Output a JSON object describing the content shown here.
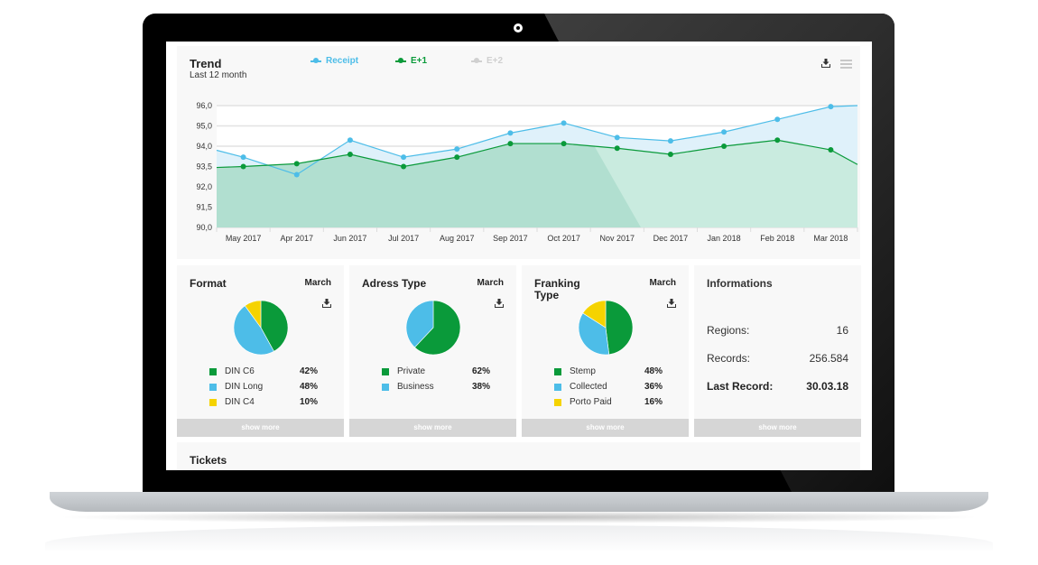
{
  "trend": {
    "title": "Trend",
    "subtitle": "Last 12 month",
    "legend": [
      {
        "label": "Receipt",
        "color": "#4dbde8"
      },
      {
        "label": "E+1",
        "color": "#0a9a3a"
      },
      {
        "label": "E+2",
        "color": "#d0d0d0"
      }
    ],
    "download_icon": "download-icon",
    "menu_icon": "hamburger-menu-icon"
  },
  "chart_data": [
    {
      "type": "area",
      "title": "Trend",
      "subtitle": "Last 12 month",
      "categories": [
        "May 2017",
        "Apr 2017",
        "Jun 2017",
        "Jul 2017",
        "Aug 2017",
        "Sep 2017",
        "Oct 2017",
        "Nov 2017",
        "Dec 2017",
        "Jan 2018",
        "Feb 2018",
        "Mar 2018"
      ],
      "y_tick_labels": [
        "96,0",
        "95,0",
        "94,0",
        "93,5",
        "92,0",
        "91,5",
        "90,0"
      ],
      "y_tick_values": [
        96.0,
        95.0,
        94.0,
        93.5,
        92.0,
        91.5,
        90.0
      ],
      "ylim": [
        90.0,
        96.0
      ],
      "grid": true,
      "legend_position": "top",
      "series": [
        {
          "name": "Receipt",
          "color": "#4dbde8",
          "start": 93.9,
          "values": [
            93.73,
            92.9,
            94.3,
            93.73,
            93.93,
            94.65,
            95.14,
            94.43,
            94.26,
            94.7,
            95.32,
            95.95
          ],
          "end": 96.0
        },
        {
          "name": "E+1",
          "color": "#0a9a3a",
          "start": 93.43,
          "values": [
            93.5,
            93.57,
            93.8,
            93.5,
            93.73,
            94.13,
            94.13,
            93.95,
            93.8,
            94.0,
            94.3,
            93.91
          ],
          "end": 93.55
        },
        {
          "name": "E+2",
          "color": "#d0d0d0",
          "values": []
        }
      ]
    },
    {
      "type": "pie",
      "title": "Format",
      "period": "March",
      "slices": [
        {
          "label": "DIN C6",
          "value": 42,
          "display": "42%",
          "color": "#0a9a3a"
        },
        {
          "label": "DIN Long",
          "value": 48,
          "display": "48%",
          "color": "#4dbde8"
        },
        {
          "label": "DIN C4",
          "value": 10,
          "display": "10%",
          "color": "#f5d300"
        }
      ]
    },
    {
      "type": "pie",
      "title": "Adress Type",
      "period": "March",
      "slices": [
        {
          "label": "Private",
          "value": 62,
          "display": "62%",
          "color": "#0a9a3a"
        },
        {
          "label": "Business",
          "value": 38,
          "display": "38%",
          "color": "#4dbde8"
        }
      ]
    },
    {
      "type": "pie",
      "title": "Franking Type",
      "period": "March",
      "slices": [
        {
          "label": "Stemp",
          "value": 48,
          "display": "48%",
          "color": "#0a9a3a"
        },
        {
          "label": "Collected",
          "value": 36,
          "display": "36%",
          "color": "#4dbde8"
        },
        {
          "label": "Porto Paid",
          "value": 16,
          "display": "16%",
          "color": "#f5d300"
        }
      ]
    }
  ],
  "cards": [
    {
      "title": "Format",
      "month": "March",
      "show_more": "show more"
    },
    {
      "title": "Adress Type",
      "month": "March",
      "show_more": "show more"
    },
    {
      "title": "Franking Type",
      "month": "March",
      "show_more": "show more"
    }
  ],
  "info": {
    "title": "Informations",
    "rows": [
      {
        "label": "Regions:",
        "value": "16"
      },
      {
        "label": "Records:",
        "value": "256.584"
      },
      {
        "label": "Last Record:",
        "value": "30.03.18"
      }
    ],
    "show_more": "show more"
  },
  "tickets": {
    "title": "Tickets"
  }
}
